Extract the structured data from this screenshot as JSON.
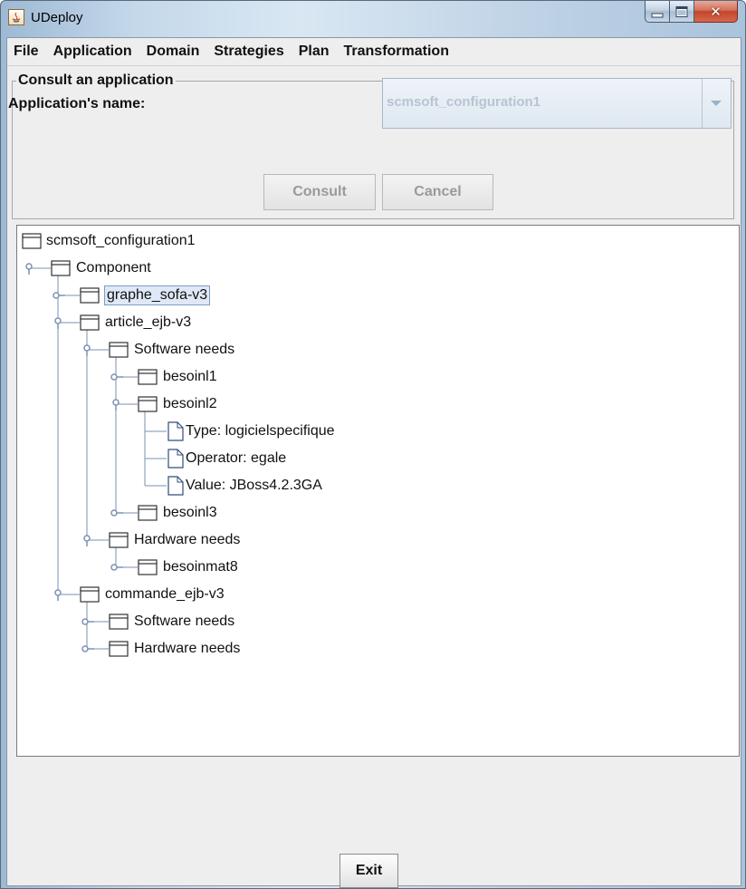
{
  "window": {
    "title": "UDeploy",
    "controls": {
      "minimize": "minimize",
      "maximize": "maximize",
      "close": "✕"
    }
  },
  "menubar": {
    "items": [
      "File",
      "Application",
      "Domain",
      "Strategies",
      "Plan",
      "Transformation"
    ]
  },
  "consult": {
    "legend": "Consult an application",
    "app_name_label": "Application's name:",
    "combo_value": "scmsoft_configuration1",
    "consult_label": "Consult",
    "cancel_label": "Cancel"
  },
  "tree": {
    "nodes": [
      {
        "label": "scmsoft_configuration1",
        "depth": 0,
        "kind": "folder"
      },
      {
        "label": "Component",
        "depth": 1,
        "kind": "folder",
        "toggle": "expanded"
      },
      {
        "label": "graphe_sofa-v3",
        "depth": 2,
        "kind": "folder",
        "toggle": "collapsed",
        "selected": true
      },
      {
        "label": "article_ejb-v3",
        "depth": 2,
        "kind": "folder",
        "toggle": "expanded"
      },
      {
        "label": "Software needs",
        "depth": 3,
        "kind": "folder",
        "toggle": "expanded"
      },
      {
        "label": "besoinl1",
        "depth": 4,
        "kind": "folder",
        "toggle": "collapsed"
      },
      {
        "label": "besoinl2",
        "depth": 4,
        "kind": "folder",
        "toggle": "expanded"
      },
      {
        "label": "Type: logicielspecifique",
        "depth": 5,
        "kind": "file"
      },
      {
        "label": "Operator: egale",
        "depth": 5,
        "kind": "file"
      },
      {
        "label": "Value: JBoss4.2.3GA",
        "depth": 5,
        "kind": "file"
      },
      {
        "label": "besoinl3",
        "depth": 4,
        "kind": "folder",
        "toggle": "collapsed"
      },
      {
        "label": "Hardware needs",
        "depth": 3,
        "kind": "folder",
        "toggle": "expanded"
      },
      {
        "label": "besoinmat8",
        "depth": 4,
        "kind": "folder",
        "toggle": "collapsed"
      },
      {
        "label": "commande_ejb-v3",
        "depth": 2,
        "kind": "folder",
        "toggle": "expanded"
      },
      {
        "label": "Software needs",
        "depth": 3,
        "kind": "folder",
        "toggle": "collapsed"
      },
      {
        "label": "Hardware needs",
        "depth": 3,
        "kind": "folder",
        "toggle": "collapsed"
      }
    ]
  },
  "footer": {
    "exit_label": "Exit"
  },
  "colors": {
    "tree_line": "#7a92b3",
    "selection_bg": "#dfe8f6",
    "close_button": "#c2452b"
  },
  "icons": {
    "folder": "folder-icon",
    "file": "file-icon",
    "app": "java-app-icon"
  }
}
